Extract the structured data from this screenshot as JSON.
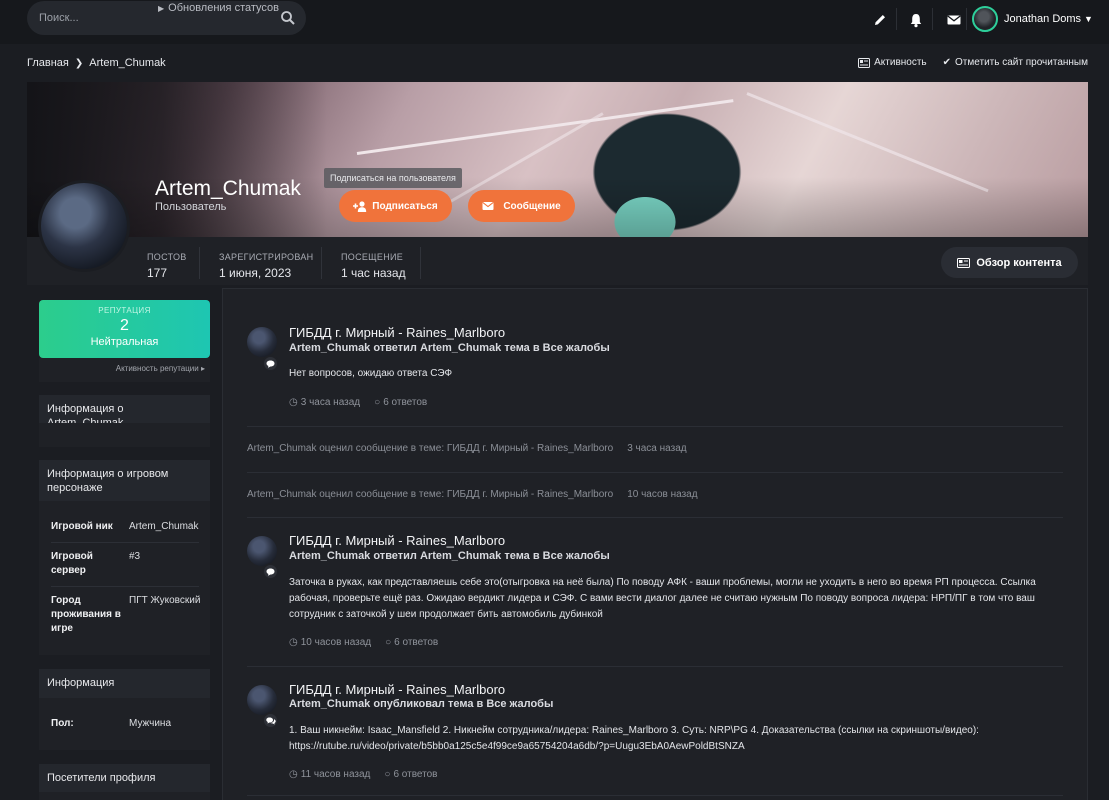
{
  "header": {
    "search_placeholder": "Поиск...",
    "status_updates": "Обновления статусов",
    "user_name": "Jonathan Doms"
  },
  "breadcrumb": {
    "home": "Главная",
    "current": "Artem_Chumak"
  },
  "top_actions": {
    "activity": "Активность",
    "mark_read": "Отметить сайт прочитанным"
  },
  "profile": {
    "name": "Artem_Chumak",
    "role": "Пользователь",
    "follow_tooltip": "Подписаться на пользователя",
    "follow_button": "Подписаться",
    "message_button": "Сообщение",
    "content_overview": "Обзор контента"
  },
  "stats": [
    {
      "label": "ПОСТОВ",
      "value": "177"
    },
    {
      "label": "ЗАРЕГИСТРИРОВАН",
      "value": "1 июня, 2023"
    },
    {
      "label": "ПОСЕЩЕНИЕ",
      "value": "1 час назад"
    }
  ],
  "reputation": {
    "label": "РЕПУТАЦИЯ",
    "value": "2",
    "status": "Нейтральная",
    "link": "Активность репутации"
  },
  "widgets": {
    "info_about": "Информация о Artem_Chumak",
    "game_char": "Информация о игровом персонаже",
    "game_rows": [
      {
        "key": "Игровой ник",
        "value": "Artem_Chumak"
      },
      {
        "key": "Игровой сервер",
        "value": "#3"
      },
      {
        "key": "Город проживания в игре",
        "value": "ПГТ Жуковский"
      }
    ],
    "info": "Информация",
    "info_rows": [
      {
        "key": "Пол:",
        "value": "Мужчина"
      }
    ],
    "visitors": "Посетители профиля"
  },
  "feed": {
    "items": [
      {
        "title": "ГИБДД г. Мирный - Raines_Marlboro",
        "subtitle": "Artem_Chumak ответил Artem_Chumak тема в Все жалобы",
        "text": "Нет вопросов, ожидаю ответа СЭФ",
        "time": "3 часа назад",
        "replies": "6 ответов"
      },
      {
        "title": "ГИБДД г. Мирный - Raines_Marlboro",
        "subtitle": "Artem_Chumak ответил Artem_Chumak тема в Все жалобы",
        "text": "Заточка в руках, как представляешь себе это(отыгровка на неё была) По поводу АФК - ваши проблемы, могли не уходить в него во время РП процесса. Ссылка рабочая, проверьте ещё раз. Ожидаю вердикт лидера и СЭФ. С вами вести диалог далее не считаю нужным По поводу вопроса лидера: НРП/ПГ в том что ваш сотрудник с заточкой у шеи продолжает бить автомобиль дубинкой",
        "time": "10 часов назад",
        "replies": "6 ответов"
      },
      {
        "title": "ГИБДД г. Мирный - Raines_Marlboro",
        "subtitle": "Artem_Chumak опубликовал тема в Все жалобы",
        "text": "1. Ваш никнейм: Isaac_Mansfield 2. Никнейм сотрудника/лидера: Raines_Marlboro 3. Суть: NRP\\PG 4. Доказательства (ссылки на скриншоты/видео): https://rutube.ru/video/private/b5bb0a125c5e4f99ce9a65754204a6db/?p=Uugu3EbA0AewPoldBtSNZA",
        "time": "11 часов назад",
        "replies": "6 ответов"
      }
    ],
    "likes": [
      {
        "text": "Artem_Chumak оценил сообщение в теме: ГИБДД г. Мирный - Raines_Marlboro",
        "time": "3 часа назад"
      },
      {
        "text": "Artem_Chumak оценил сообщение в теме: ГИБДД г. Мирный - Raines_Marlboro",
        "time": "10 часов назад"
      }
    ]
  },
  "colors": {
    "accent_orange": "#f0733b",
    "reputation_green": "#2ccd8c",
    "background": "#1b1d22"
  }
}
